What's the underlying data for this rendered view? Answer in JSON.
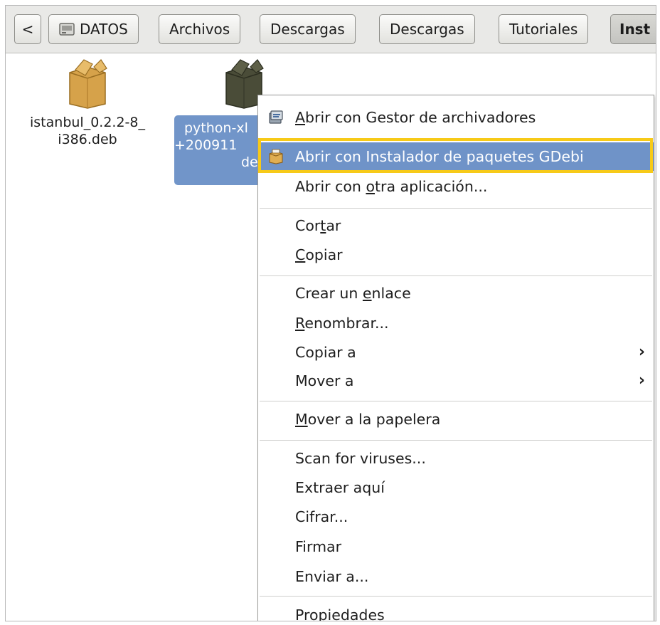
{
  "pathbar": {
    "back_label": "<",
    "crumbs": [
      {
        "label": "DATOS",
        "icon": "drive-icon"
      },
      {
        "label": "Archivos"
      },
      {
        "label": "Descargas"
      },
      {
        "label": "Descargas"
      },
      {
        "label": "Tutoriales"
      },
      {
        "label": "Inst"
      }
    ]
  },
  "files": [
    {
      "line1": "istanbul_0.2.2-8_",
      "line2": "i386.deb",
      "icon": "package-icon",
      "icon_color": "#d6a24a"
    },
    {
      "line1": "python-xl",
      "line2": "+200911",
      "line3": "de",
      "icon": "package-icon",
      "icon_color": "#4a4c38",
      "selected": true
    }
  ],
  "context_menu": {
    "items": [
      {
        "label": "Abrir con Gestor de archivadores",
        "icon": "archive-manager-icon",
        "mnemonic": "A"
      },
      {
        "label": "Abrir con Instalador de paquetes GDebi",
        "icon": "gdebi-package-icon",
        "highlighted": true
      },
      {
        "label": "Abrir con otra aplicación...",
        "mnemonic": "o"
      },
      {
        "label": "Cortar",
        "mnemonic": "t"
      },
      {
        "label": "Copiar",
        "mnemonic": "C"
      },
      {
        "label": "Crear un enlace",
        "mnemonic": "e"
      },
      {
        "label": "Renombrar...",
        "mnemonic": "R"
      },
      {
        "label": "Copiar a",
        "submenu": true
      },
      {
        "label": "Mover a",
        "submenu": true
      },
      {
        "label": "Mover a la papelera",
        "mnemonic": "M"
      },
      {
        "label": "Scan for viruses..."
      },
      {
        "label": "Extraer aquí"
      },
      {
        "label": "Cifrar..."
      },
      {
        "label": "Firmar"
      },
      {
        "label": "Enviar a..."
      },
      {
        "label": "Propiedades",
        "mnemonic": "P"
      }
    ],
    "submenu_arrow": "›"
  },
  "colors": {
    "selection": "#7195c9",
    "menu_highlight": "#6f93c8",
    "annotation_outline": "#f7ca18"
  }
}
